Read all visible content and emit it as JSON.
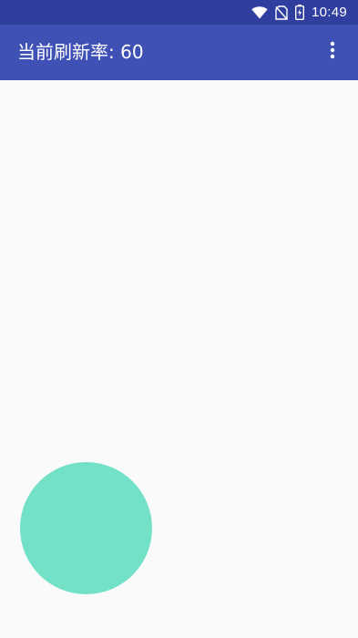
{
  "status_bar": {
    "time": "10:49",
    "icons": [
      "wifi-icon",
      "no-sim-icon",
      "battery-charging-icon"
    ],
    "background_color": "#303f9f"
  },
  "app_bar": {
    "title": "当前刷新率: 60",
    "menu_icon": "more-vert-icon",
    "background_color": "#3f51b5"
  },
  "content": {
    "background_color": "#fafafa",
    "ball_color": "#73e0c8"
  }
}
